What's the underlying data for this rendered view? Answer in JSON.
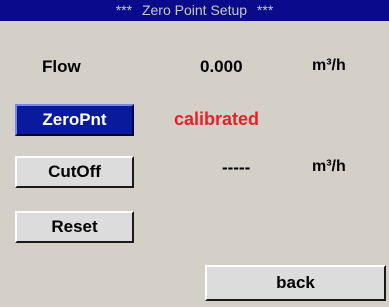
{
  "title": {
    "prefix": "***",
    "text": "Zero Point Setup",
    "suffix": "***"
  },
  "flow": {
    "label": "Flow",
    "value": "0.000",
    "unit": "m³/h"
  },
  "zeropnt": {
    "button_label": "ZeroPnt",
    "status": "calibrated"
  },
  "cutoff": {
    "button_label": "CutOff",
    "value": "-----",
    "unit": "m³/h"
  },
  "reset": {
    "button_label": "Reset"
  },
  "back": {
    "button_label": "back"
  },
  "colors": {
    "title_bg": "#0a0a8c",
    "active_button_bg": "#0a1a9c",
    "status_text": "#e8202a",
    "panel_bg": "#d4d0c8"
  }
}
